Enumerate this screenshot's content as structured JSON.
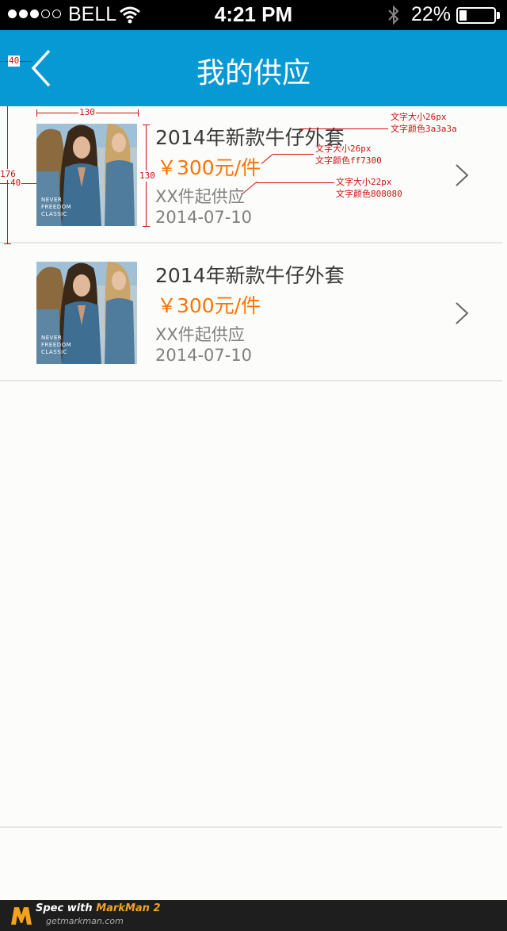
{
  "status_bar": {
    "carrier": "BELL",
    "time": "4:21 PM",
    "battery": "22%",
    "battery_level": 0.22,
    "signal_bars": 3,
    "signal_total": 5
  },
  "nav": {
    "title": "我的供应"
  },
  "items": [
    {
      "title": "2014年新款牛仔外套",
      "price": "￥300元/件",
      "moq": "XX件起供应",
      "date": "2014-07-10",
      "image_caption": "NEVER FREEDOM CLASSIC"
    },
    {
      "title": "2014年新款牛仔外套",
      "price": "￥300元/件",
      "moq": "XX件起供应",
      "date": "2014-07-10",
      "image_caption": "NEVER FREEDOM CLASSIC"
    }
  ],
  "annotations": {
    "back_offset": "40",
    "img_width": "130",
    "img_height": "130",
    "row_height": "176",
    "img_left": "40",
    "title_size": "文字大小26px",
    "title_color": "文字颜色3a3a3a",
    "price_size": "文字大小26px",
    "price_color": "文字颜色ff7300",
    "moq_size": "文字大小22px",
    "moq_color": "文字颜色808080"
  },
  "footer": {
    "spec_with": "Spec with ",
    "brand": "MarkMan 2",
    "url": "getmarkman.com"
  },
  "colors": {
    "nav_bg": "#0799d3",
    "title": "#3a3a3a",
    "price": "#ff7300",
    "secondary": "#808080"
  }
}
